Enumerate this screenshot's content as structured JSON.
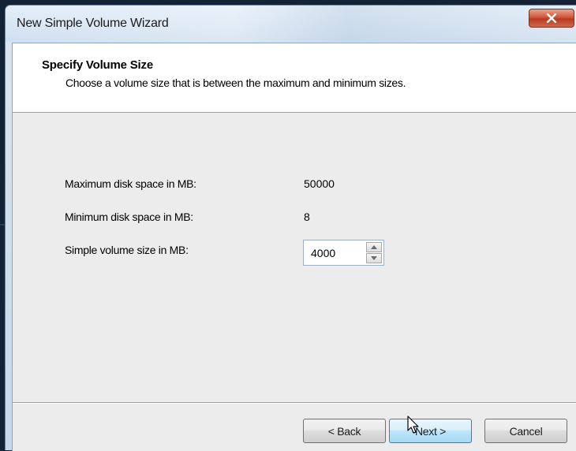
{
  "window": {
    "title": "New Simple Volume Wizard",
    "close_icon": "close-icon"
  },
  "header": {
    "title": "Specify Volume Size",
    "subtitle": "Choose a volume size that is between the maximum and minimum sizes."
  },
  "fields": {
    "max_label": "Maximum disk space in MB:",
    "max_value": "50000",
    "min_label": "Minimum disk space in MB:",
    "min_value": "8",
    "size_label": "Simple volume size in MB:",
    "size_value": "4000"
  },
  "buttons": {
    "back": "< Back",
    "next": "Next >",
    "cancel": "Cancel"
  },
  "colors": {
    "close_button": "#c94a2c",
    "next_button_accent": "#3c7fb1",
    "desktop_background": "#142236"
  }
}
